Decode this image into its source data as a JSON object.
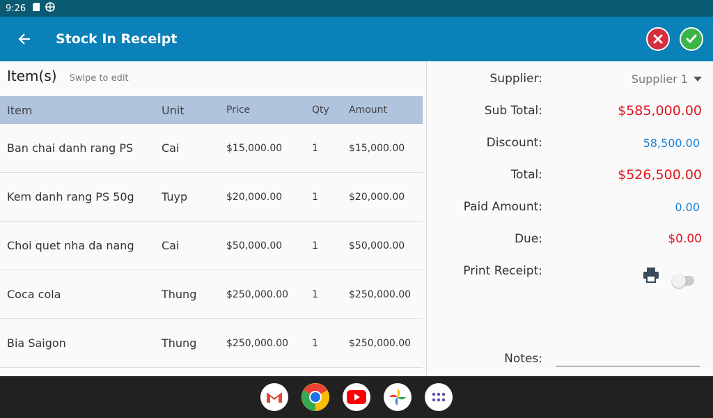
{
  "status": {
    "time": "9:26"
  },
  "appbar": {
    "title": "Stock In Receipt"
  },
  "items_panel": {
    "title": "Item(s)",
    "hint": "Swipe to edit",
    "columns": [
      "Item",
      "Unit",
      "Price",
      "Qty",
      "Amount"
    ],
    "rows": [
      {
        "item": "Ban chai danh rang PS",
        "unit": "Cai",
        "price": "$15,000.00",
        "qty": "1",
        "amount": "$15,000.00"
      },
      {
        "item": "Kem danh rang PS 50g",
        "unit": "Tuyp",
        "price": "$20,000.00",
        "qty": "1",
        "amount": "$20,000.00"
      },
      {
        "item": "Choi quet nha da nang",
        "unit": "Cai",
        "price": "$50,000.00",
        "qty": "1",
        "amount": "$50,000.00"
      },
      {
        "item": "Coca cola",
        "unit": "Thung",
        "price": "$250,000.00",
        "qty": "1",
        "amount": "$250,000.00"
      },
      {
        "item": "Bia Saigon",
        "unit": "Thung",
        "price": "$250,000.00",
        "qty": "1",
        "amount": "$250,000.00"
      }
    ]
  },
  "summary": {
    "supplier_label": "Supplier:",
    "supplier_value": "Supplier 1",
    "subtotal_label": "Sub Total:",
    "subtotal_value": "$585,000.00",
    "discount_label": "Discount:",
    "discount_value": "58,500.00",
    "total_label": "Total:",
    "total_value": "$526,500.00",
    "paid_label": "Paid Amount:",
    "paid_value": "0.00",
    "due_label": "Due:",
    "due_value": "$0.00",
    "print_label": "Print Receipt:",
    "print_enabled": false,
    "notes_label": "Notes:",
    "notes_value": ""
  },
  "colors": {
    "appbar": "#0a81b8",
    "statusbar": "#0b5a73",
    "red": "#e0141e",
    "blue": "#1a7fd1",
    "table_header": "#b0c4de"
  },
  "dock": [
    "gmail-icon",
    "chrome-icon",
    "youtube-icon",
    "photos-icon",
    "app-drawer-icon"
  ]
}
